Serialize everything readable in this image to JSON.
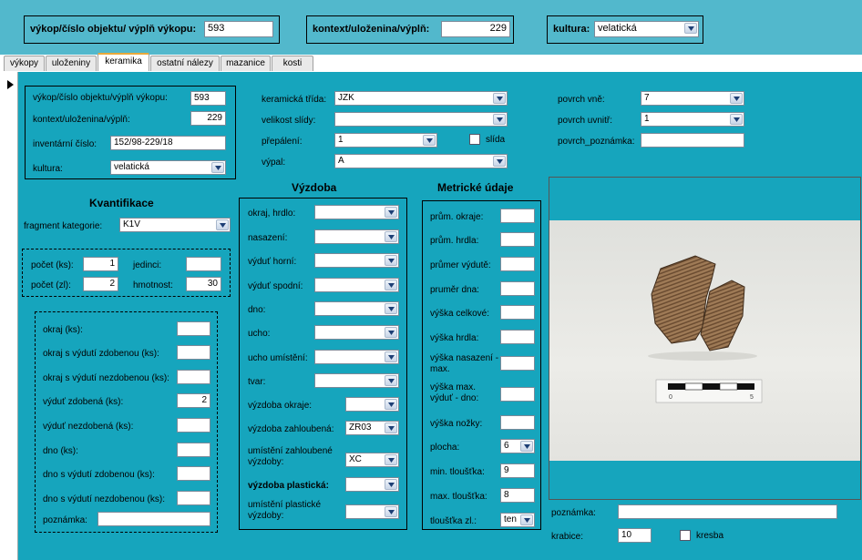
{
  "header": {
    "vykop_label": "výkop/číslo objektu/ výplň výkopu:",
    "vykop_value": "593",
    "kontext_label": "kontext/uloženina/výplň:",
    "kontext_value": "229",
    "kultura_label": "kultura:",
    "kultura_value": "velatická"
  },
  "tabs": [
    "výkopy",
    "uloženiny",
    "keramika",
    "ostatní nálezy",
    "mazanice",
    "kosti"
  ],
  "active_tab": "keramika",
  "ident": {
    "vykop_label": "výkop/číslo objektu/výplň výkopu:",
    "vykop_value": "593",
    "kontext_label": "kontext/uloženina/výplň:",
    "kontext_value": "229",
    "inventar_label": "inventární číslo:",
    "inventar_value": "152/98-229/18",
    "kultura_label": "kultura:",
    "kultura_value": "velatická"
  },
  "props": {
    "trida_label": "keramická třída:",
    "trida_value": "JZK",
    "slida_label": "velikost slídy:",
    "slida_value": "",
    "prepaleni_label": "přepálení:",
    "prepaleni_value": "1",
    "slida_check_label": "slída",
    "vypal_label": "výpal:",
    "vypal_value": "A",
    "povrch_vne_label": "povrch vně:",
    "povrch_vne_value": "7",
    "povrch_uvnitr_label": "povrch uvnitř:",
    "povrch_uvnitr_value": "1",
    "povrch_pozn_label": "povrch_poznámka:",
    "povrch_pozn_value": ""
  },
  "kvantifikace": {
    "title": "Kvantifikace",
    "fragment_label": "fragment kategorie:",
    "fragment_value": "K1V",
    "pocet_ks_label": "počet (ks):",
    "pocet_ks_value": "1",
    "jedinci_label": "jedinci:",
    "jedinci_value": "",
    "pocet_zl_label": "počet (zl):",
    "pocet_zl_value": "2",
    "hmotnost_label": "hmotnost:",
    "hmotnost_value": "30"
  },
  "counts": [
    {
      "label": "okraj (ks):",
      "value": ""
    },
    {
      "label": "okraj s výdutí zdobenou (ks):",
      "value": ""
    },
    {
      "label": "okraj s výdutí nezdobenou (ks):",
      "value": ""
    },
    {
      "label": "výduť zdobená (ks):",
      "value": "2"
    },
    {
      "label": "výduť nezdobená (ks):",
      "value": ""
    },
    {
      "label": "dno (ks):",
      "value": ""
    },
    {
      "label": "dno s výdutí zdobenou (ks):",
      "value": ""
    },
    {
      "label": "dno s výdutí nezdobenou (ks):",
      "value": ""
    }
  ],
  "counts_note_label": "poznámka:",
  "counts_note_value": "",
  "vyzdoba": {
    "title": "Výzdoba",
    "fields": [
      {
        "label": "okraj, hrdlo:",
        "value": ""
      },
      {
        "label": "nasazení:",
        "value": ""
      },
      {
        "label": "výduť horní:",
        "value": ""
      },
      {
        "label": "výduť spodní:",
        "value": ""
      },
      {
        "label": "dno:",
        "value": ""
      },
      {
        "label": "ucho:",
        "value": ""
      },
      {
        "label": "ucho umístění:",
        "value": ""
      },
      {
        "label": "tvar:",
        "value": ""
      }
    ],
    "okraje_label": "výzdoba okraje:",
    "okraje_value": "",
    "zahloubena_label": "výzdoba zahloubená:",
    "zahloubena_value": "ZR03",
    "umisteni_zahl_label": "umístění zahloubené výzdoby:",
    "umisteni_zahl_value": "XC",
    "plasticka_label": "výzdoba plastická:",
    "plasticka_value": "",
    "umisteni_plast_label": "umístění plastické výzdoby:",
    "umisteni_plast_value": ""
  },
  "metricke": {
    "title": "Metrické údaje",
    "fields": [
      {
        "label": "prům. okraje:",
        "value": ""
      },
      {
        "label": "prům. hrdla:",
        "value": ""
      },
      {
        "label": "průmer výdutě:",
        "value": ""
      },
      {
        "label": "pruměr dna:",
        "value": ""
      },
      {
        "label": "výška celkové:",
        "value": ""
      },
      {
        "label": "výška hrdla:",
        "value": ""
      },
      {
        "label": "výška nasazení - max.",
        "value": ""
      },
      {
        "label": "výška max. výduť - dno:",
        "value": ""
      },
      {
        "label": "výška nožky:",
        "value": ""
      }
    ],
    "plocha_label": "plocha:",
    "plocha_value": "6",
    "min_label": "min. tloušťka:",
    "min_value": "9",
    "max_label": "max. tloušťka:",
    "max_value": "8",
    "zl_label": "tloušťka zl.:",
    "zl_value": "ten"
  },
  "photo": {
    "scale_0": "0",
    "scale_5": "5"
  },
  "footer": {
    "poznamka_label": "poznámka:",
    "poznamka_value": "",
    "krabice_label": "krabice:",
    "krabice_value": "10",
    "kresba_label": "kresba"
  },
  "colors": {
    "panel": "#16a5bd",
    "header": "#52b8cc"
  }
}
